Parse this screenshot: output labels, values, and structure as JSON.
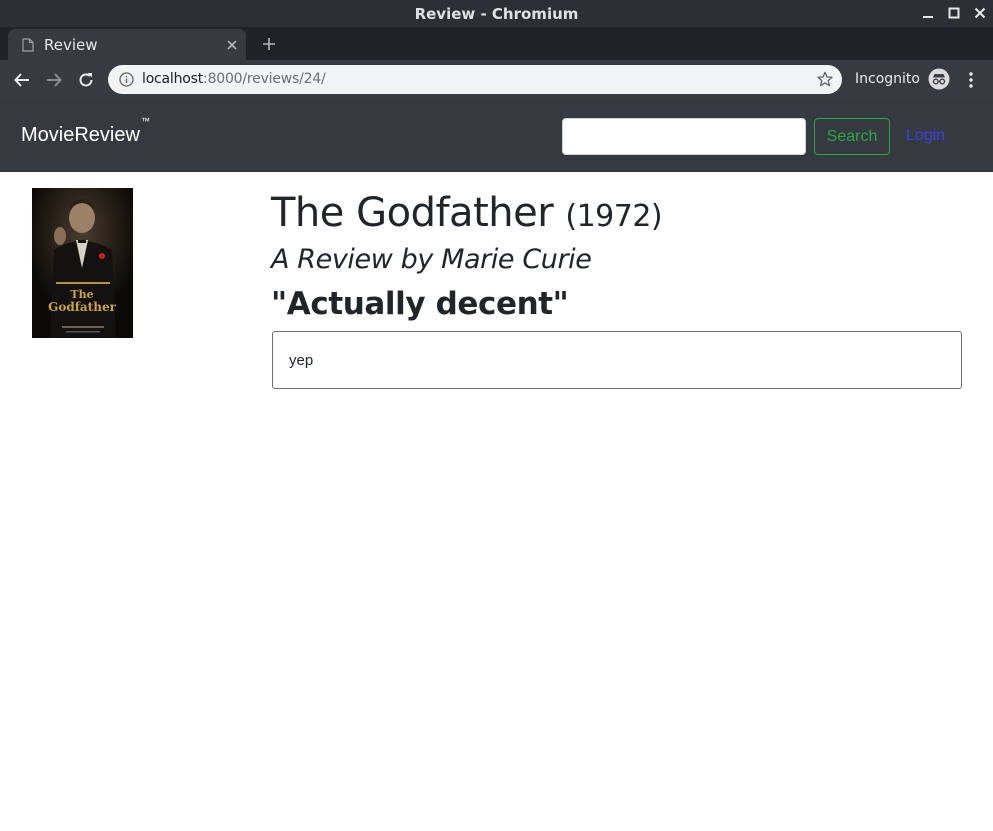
{
  "window": {
    "title": "Review - Chromium"
  },
  "tabs": [
    {
      "title": "Review",
      "active": true
    }
  ],
  "toolbar": {
    "url_host": "localhost",
    "url_path": ":8000/reviews/24/",
    "incognito_label": "Incognito"
  },
  "navbar": {
    "brand": "MovieReview",
    "brand_mark": "™",
    "search_value": "",
    "search_button": "Search",
    "login_link": "Login",
    "accent_success": "#28a745",
    "link_color": "#3f3fe0"
  },
  "movie": {
    "title": "The Godfather",
    "year": "(1972)",
    "poster_text_line1": "The",
    "poster_text_line2": "Godfather"
  },
  "review": {
    "byline": "A Review by Marie Curie",
    "headline": "\"Actually decent\"",
    "body": "yep"
  }
}
